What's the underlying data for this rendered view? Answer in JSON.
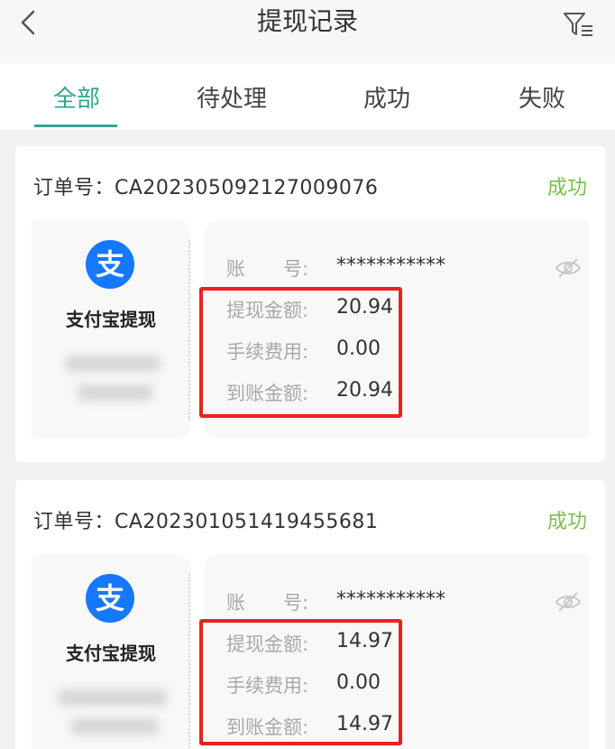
{
  "header": {
    "title": "提现记录",
    "back_icon": "chevron-left-icon",
    "filter_icon": "filter-list-icon"
  },
  "tabs": [
    {
      "label": "全部",
      "active": true
    },
    {
      "label": "待处理",
      "active": false
    },
    {
      "label": "成功",
      "active": false
    },
    {
      "label": "失败",
      "active": false
    }
  ],
  "colors": {
    "accent": "#2fa88f",
    "success": "#7cbf4a",
    "alipay": "#1677ff",
    "highlight": "#e8231e"
  },
  "records": [
    {
      "order_prefix": "订单号：",
      "order_no": "CA202305092127009076",
      "status": "成功",
      "method": "支付宝提现",
      "account_label": "账　　号:",
      "account_value": "***********",
      "amount_label": "提现金额:",
      "amount_value": "20.94",
      "fee_label": "手续费用:",
      "fee_value": "0.00",
      "received_label": "到账金额:",
      "received_value": "20.94"
    },
    {
      "order_prefix": "订单号：",
      "order_no": "CA202301051419455681",
      "status": "成功",
      "method": "支付宝提现",
      "account_label": "账　　号:",
      "account_value": "***********",
      "amount_label": "提现金额:",
      "amount_value": "14.97",
      "fee_label": "手续费用:",
      "fee_value": "0.00",
      "received_label": "到账金额:",
      "received_value": "14.97"
    }
  ]
}
